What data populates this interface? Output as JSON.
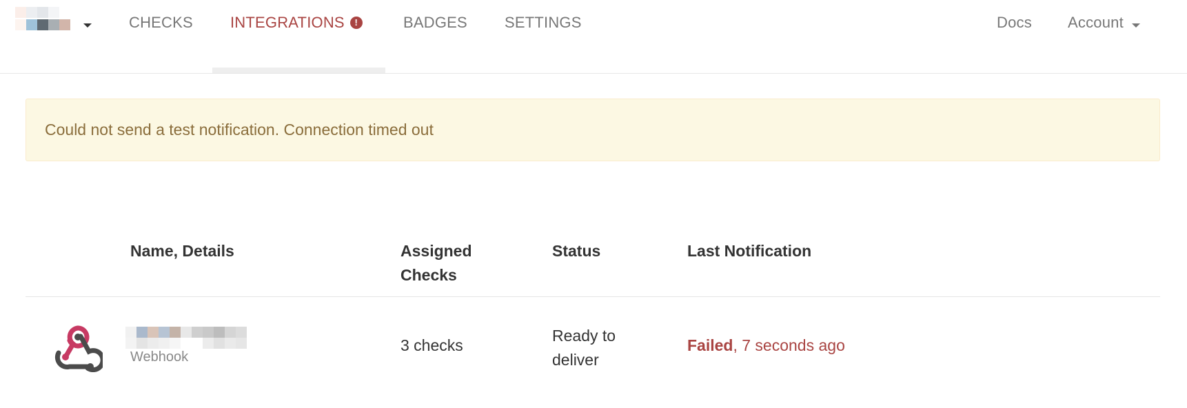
{
  "navbar": {
    "project_switcher_caret": "caret-down-icon",
    "items": [
      {
        "label": "CHECKS",
        "active": false
      },
      {
        "label": "INTEGRATIONS",
        "active": true,
        "alert_badge": "!"
      },
      {
        "label": "BADGES",
        "active": false
      },
      {
        "label": "SETTINGS",
        "active": false
      }
    ],
    "right_items": [
      {
        "label": "Docs"
      },
      {
        "label": "Account",
        "has_caret": true
      }
    ],
    "active_color": "#a94442",
    "inactive_color": "#777777"
  },
  "alert": {
    "message": "Could not send a test notification. Connection timed out",
    "background": "#fcf8e3",
    "text_color": "#8a6d3b"
  },
  "table": {
    "headers": {
      "name": "Name, Details",
      "assigned": "Assigned Checks",
      "status": "Status",
      "last": "Last Notification"
    },
    "rows": [
      {
        "icon": "webhook-icon",
        "kind": "Webhook",
        "assigned": "3 checks",
        "status": "Ready to deliver",
        "last_status": "Failed",
        "last_time": ", 7 seconds ago"
      }
    ]
  }
}
